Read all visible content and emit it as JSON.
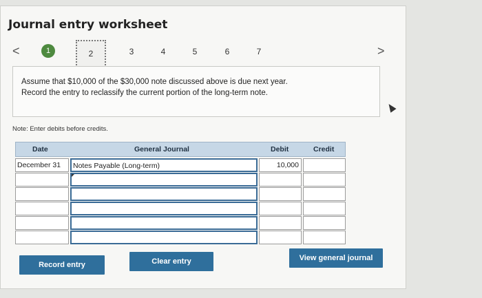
{
  "title": "Journal entry worksheet",
  "nav": {
    "prev": "<",
    "next": ">",
    "steps": [
      "1",
      "2",
      "3",
      "4",
      "5",
      "6",
      "7"
    ],
    "active_step": "1",
    "current_step": "2"
  },
  "prompt": {
    "line1": "Assume that $10,000 of the $30,000 note discussed above is due next year.",
    "line2": "Record the entry to reclassify the current portion of the long-term note."
  },
  "note": "Note: Enter debits before credits.",
  "journal": {
    "headers": {
      "date": "Date",
      "general_journal": "General Journal",
      "debit": "Debit",
      "credit": "Credit"
    },
    "rows": [
      {
        "date": "December 31",
        "account": "Notes Payable (Long-term)",
        "debit": "10,000",
        "credit": ""
      },
      {
        "date": "",
        "account": "",
        "debit": "",
        "credit": ""
      },
      {
        "date": "",
        "account": "",
        "debit": "",
        "credit": ""
      },
      {
        "date": "",
        "account": "",
        "debit": "",
        "credit": ""
      },
      {
        "date": "",
        "account": "",
        "debit": "",
        "credit": ""
      },
      {
        "date": "",
        "account": "",
        "debit": "",
        "credit": ""
      }
    ]
  },
  "buttons": {
    "record": "Record entry",
    "clear": "Clear entry",
    "view": "View general journal"
  },
  "colors": {
    "accent": "#2f6f9c",
    "step_active": "#4e8a3f",
    "header_bg": "#c6d7e6"
  }
}
